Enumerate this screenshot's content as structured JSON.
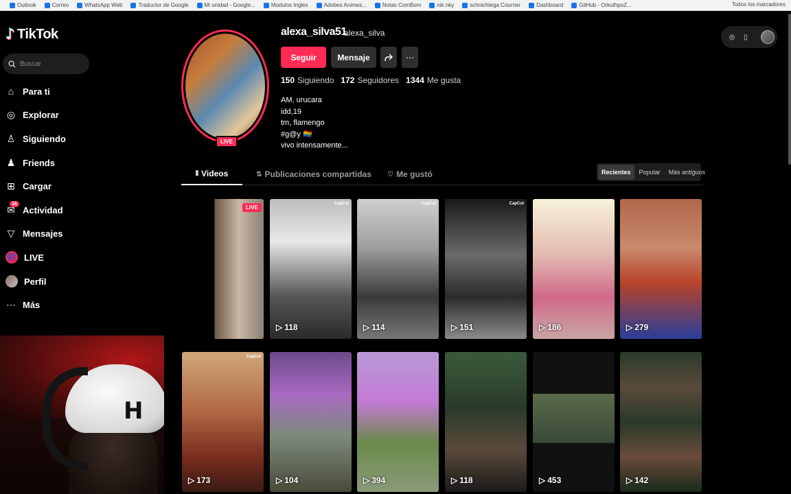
{
  "bookmarks": [
    "Outlook",
    "Correo",
    "WhatsApp Web",
    "Traductor de Google",
    "Mi unidad - Google...",
    "Modulos Ingles",
    "Adobes Animes...",
    "Notas ComBom",
    "nik nky",
    "schnichtega Courrier",
    "Dashboard",
    "GitHub - OrkuthpoZ..."
  ],
  "bookmarks_right": "Todos los marcadores",
  "sidebar": {
    "logo_text": "TikTok",
    "search_placeholder": "Buscar",
    "items": [
      {
        "label": "Para ti",
        "icon": "home-icon",
        "glyph": "⌂"
      },
      {
        "label": "Explorar",
        "icon": "compass-icon",
        "glyph": "◎"
      },
      {
        "label": "Siguiendo",
        "icon": "following-icon",
        "glyph": "♙"
      },
      {
        "label": "Friends",
        "icon": "friends-icon",
        "glyph": "♟"
      },
      {
        "label": "Cargar",
        "icon": "upload-icon",
        "glyph": "⊞"
      },
      {
        "label": "Actividad",
        "icon": "activity-icon",
        "glyph": "✉",
        "badge": "16"
      },
      {
        "label": "Mensajes",
        "icon": "messages-icon",
        "glyph": "▽"
      },
      {
        "label": "LIVE",
        "icon": "live-avatar-icon",
        "glyph": ""
      },
      {
        "label": "Perfil",
        "icon": "profile-avatar-icon",
        "glyph": ""
      },
      {
        "label": "Más",
        "icon": "more-icon",
        "glyph": "⋯"
      }
    ]
  },
  "profile": {
    "username": "alexa_silva51",
    "nickname": "alexa_silva",
    "live_badge": "LIVE",
    "follow_label": "Seguir",
    "message_label": "Mensaje",
    "stats": [
      {
        "value": "150",
        "label": "Siguiendo"
      },
      {
        "value": "172",
        "label": "Seguidores"
      },
      {
        "value": "1344",
        "label": "Me gusta"
      }
    ],
    "bio": [
      "AM, urucara",
      "idd,19",
      "tm, flamengo",
      "#g@y 🏳️‍🌈",
      "vivo intensamente..."
    ]
  },
  "tabs": [
    {
      "label": "Videos",
      "icon": "grid-icon",
      "glyph": "⦀",
      "active": true
    },
    {
      "label": "Publicaciones compartidas",
      "icon": "repost-icon",
      "glyph": "⇅",
      "active": false
    },
    {
      "label": "Me gustó",
      "icon": "heart-outline-icon",
      "glyph": "♡",
      "active": false
    }
  ],
  "sort": [
    {
      "label": "Recientes",
      "active": true
    },
    {
      "label": "Popular",
      "active": false
    },
    {
      "label": "Más antiguos",
      "active": false
    }
  ],
  "videos": [
    {
      "views": "",
      "live": "LIVE",
      "capcut": false,
      "style": "live"
    },
    {
      "views": "118",
      "capcut": true,
      "style": "bw1"
    },
    {
      "views": "114",
      "capcut": true,
      "style": "bw2"
    },
    {
      "views": "151",
      "capcut": true,
      "style": "bw3"
    },
    {
      "views": "186",
      "capcut": false,
      "style": "pink"
    },
    {
      "views": "279",
      "capcut": false,
      "style": "boy"
    },
    {
      "views": "173",
      "capcut": true,
      "style": "warm"
    },
    {
      "views": "104",
      "capcut": false,
      "style": "game1"
    },
    {
      "views": "394",
      "capcut": false,
      "style": "game2"
    },
    {
      "views": "118",
      "capcut": false,
      "style": "green"
    },
    {
      "views": "453",
      "capcut": false,
      "style": "dark"
    },
    {
      "views": "142",
      "capcut": false,
      "style": "collage"
    }
  ],
  "capcut_label": "CapCut",
  "colors": {
    "accent": "#fe2c55",
    "background": "#000000",
    "surface": "#2f2f2f"
  }
}
